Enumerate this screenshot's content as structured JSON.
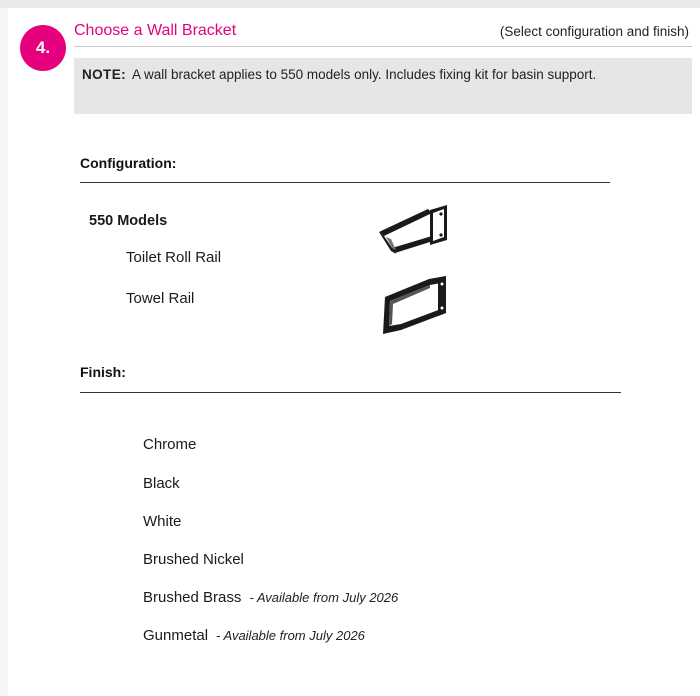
{
  "step": {
    "number": "4.",
    "title": "Choose a Wall Bracket",
    "hint": "(Select configuration and finish)",
    "accent_color": "#e6007e"
  },
  "note": {
    "label": "NOTE:",
    "text": "A wall bracket applies to 550 models only.  Includes fixing kit for basin support."
  },
  "configuration": {
    "heading": "Configuration:",
    "group_label": "550 Models",
    "options": [
      {
        "label": "Toilet Roll Rail",
        "icon": "toilet-roll-rail-bracket"
      },
      {
        "label": "Towel Rail",
        "icon": "towel-rail-bracket"
      }
    ]
  },
  "finish": {
    "heading": "Finish:",
    "options": [
      {
        "label": "Chrome",
        "note": ""
      },
      {
        "label": "Black",
        "note": ""
      },
      {
        "label": "White",
        "note": ""
      },
      {
        "label": "Brushed Nickel",
        "note": ""
      },
      {
        "label": "Brushed Brass",
        "note": "- Available from July 2026"
      },
      {
        "label": "Gunmetal",
        "note": "- Available from July 2026"
      }
    ]
  }
}
